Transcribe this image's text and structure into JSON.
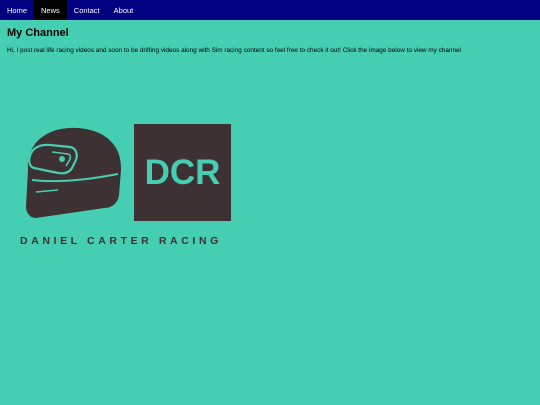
{
  "nav": {
    "items": [
      {
        "label": "Home"
      },
      {
        "label": "News"
      },
      {
        "label": "Contact"
      },
      {
        "label": "About"
      }
    ],
    "active": "News"
  },
  "main": {
    "title": "My Channel",
    "intro": "Hi, I post real life racing videos and soon to be drifting videos along with Sim racing content so feel free to check it out! Click the image below to view my channel"
  },
  "logo": {
    "monogram": "DCR",
    "wordmark": "DANIEL CARTER RACING",
    "icon": "racing-helmet-icon",
    "colors": {
      "dark": "#3d3134",
      "accent": "#46ceb2"
    }
  },
  "colors": {
    "background": "#46ceb2",
    "navbar": "#000080",
    "nav_active": "#000000"
  }
}
